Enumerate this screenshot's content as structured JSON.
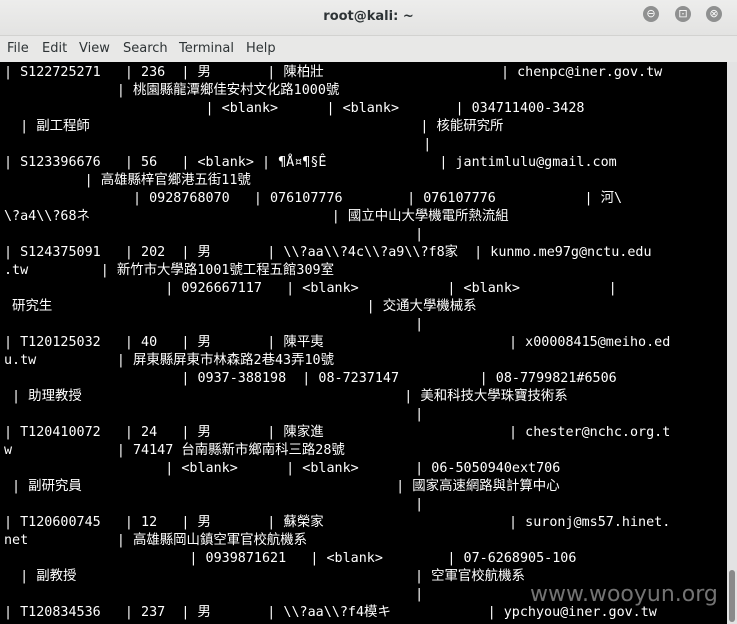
{
  "window": {
    "title": "root@kali: ~",
    "controls": {
      "minimize": "⊖",
      "maximize": "⊡",
      "close": "⊗"
    }
  },
  "menubar": [
    "File",
    "Edit",
    "View",
    "Search",
    "Terminal",
    "Help"
  ],
  "terminal": {
    "background": "#000000",
    "foreground": "#ffffff",
    "lines": [
      "| S122725271   | 236  | 男       | 陳柏壯                      | chenpc@iner.gov.tw",
      "              | 桃園縣龍潭鄉佳安村文化路1000號",
      "                         | <blank>      | <blank>       | 034711400-3428",
      "  | 副工程師                                         | 核能研究所",
      "                                                    |",
      "| S123396676   | 56   | <blank> | ¶Å¤¶§Ê              | jantimlulu@gmail.com",
      "          | 高雄縣梓官鄉港五街11號",
      "                | 0928768070   | 076107776        | 076107776           | 河\\",
      "\\?a4\\\\?68ネ                              | 國立中山大學機電所熱流組",
      "                                                   |",
      "| S124375091   | 202  | 男       | \\\\?aa\\\\?4c\\\\?a9\\\\?f8家  | kunmo.me97g@nctu.edu",
      ".tw         | 新竹市大學路1001號工程五館309室",
      "                    | 0926667117   | <blank>           | <blank>           |",
      " 研究生                                       | 交通大學機械系",
      "                                                   |",
      "| T120125032   | 40   | 男       | 陳平夷                       | x00008415@meiho.ed",
      "u.tw          | 屏東縣屏東市林森路2巷43弄10號",
      "                      | 0937-388198  | 08-7237147          | 08-7799821#6506",
      " | 助理教授                                        | 美和科技大學珠寶技術系",
      "                                                   |",
      "| T120410072   | 24   | 男       | 陳家進                       | chester@nchc.org.t",
      "w             | 74147 台南縣新市鄉南科三路28號",
      "                    | <blank>      | <blank>       | 06-5050940ext706",
      " | 副研究員                                       | 國家高速網路與計算中心",
      "                                                   |",
      "| T120600745   | 12   | 男       | 蘇榮家                       | suronj@ms57.hinet.",
      "net           | 高雄縣岡山鎮空軍官校航機系",
      "                       | 0939871621   | <blank>        | 07-6268905-106",
      "  | 副教授                                          | 空軍官校航機系",
      "                                                   |",
      "| T120834536   | 237  | 男       | \\\\?aa\\\\?f4模キ            | ypchyou@iner.gov.tw"
    ]
  },
  "watermark": "www.wooyun.org"
}
